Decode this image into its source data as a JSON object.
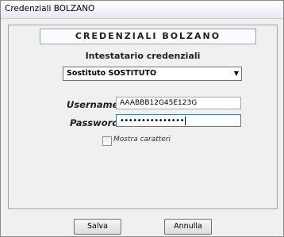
{
  "window": {
    "title": "Credenziali BOLZANO"
  },
  "header": {
    "title": "CREDENZIALI BOLZANO"
  },
  "intestatario": {
    "label": "Intestatario credenziali",
    "selected": "Sostituto SOSTITUTO"
  },
  "form": {
    "username_label": "Username",
    "username_value": "AAABBB12G45E123G",
    "password_label": "Password",
    "password_mask": "•••••••••••••••",
    "show_chars_label": "Mostra caratteri",
    "show_chars_checked": false
  },
  "buttons": {
    "save": "Salva",
    "cancel": "Annulla"
  }
}
